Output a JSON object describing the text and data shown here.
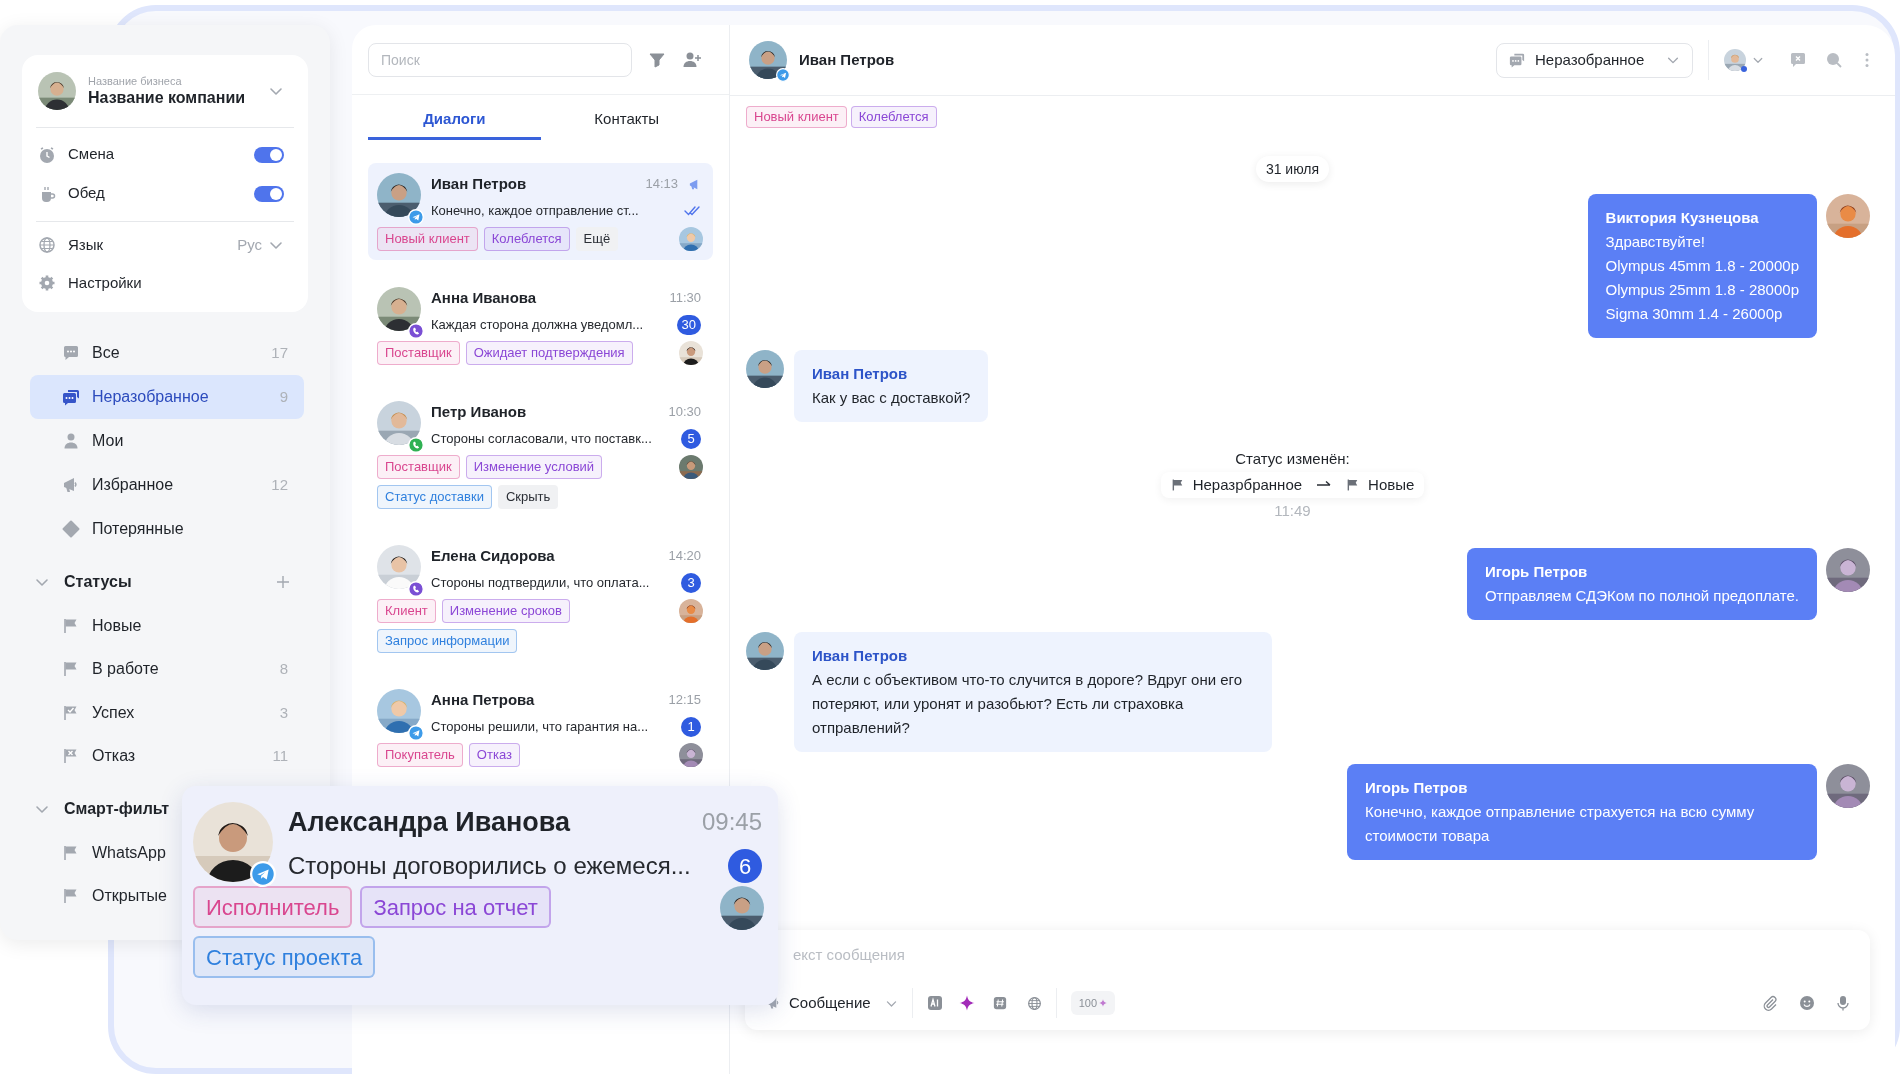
{
  "sidebar": {
    "business": {
      "caption": "Название бизнеса",
      "name": "Название компании"
    },
    "toggles": [
      {
        "label": "Смена",
        "on": true
      },
      {
        "label": "Обед",
        "on": true
      }
    ],
    "language": {
      "label": "Язык",
      "value": "Рус"
    },
    "settings": {
      "label": "Настройки"
    },
    "folders": [
      {
        "label": "Все",
        "count": "17",
        "selected": false
      },
      {
        "label": "Неразобранное",
        "count": "9",
        "selected": true
      },
      {
        "label": "Мои",
        "selected": false
      },
      {
        "label": "Избранное",
        "count": "12",
        "selected": false
      },
      {
        "label": "Потерянные",
        "selected": false
      }
    ],
    "sections": [
      {
        "title": "Статусы",
        "expanded": true,
        "items": [
          {
            "label": "Новые",
            "kind": "flag"
          },
          {
            "label": "В работе",
            "count": "8",
            "kind": "flag"
          },
          {
            "label": "Успех",
            "count": "3",
            "kind": "success"
          },
          {
            "label": "Отказ",
            "count": "11",
            "kind": "refusal"
          }
        ]
      },
      {
        "title": "Смарт-фильт",
        "expanded": true,
        "items": [
          {
            "label": "WhatsApp",
            "kind": "flag"
          },
          {
            "label": "Открытые",
            "kind": "flag"
          }
        ]
      }
    ]
  },
  "chat_list": {
    "search": {
      "placeholder": "Поиск"
    },
    "tabs": [
      {
        "label": "Диалоги",
        "selected": true
      },
      {
        "label": "Контакты",
        "selected": false
      }
    ],
    "dialogs": [
      {
        "name": "Иван Петров",
        "time": "14:13",
        "preview": "Конечно, каждое отправление ст...",
        "kind": "telegram",
        "pinned": true,
        "read": true,
        "selected": true,
        "tags": [
          {
            "label": "Новый клиент",
            "color": "#d9468f"
          },
          {
            "label": "Колеблется",
            "color": "#8b47d6"
          }
        ],
        "action": {
          "label": "Ещё"
        }
      },
      {
        "name": "Анна Иванова",
        "time": "11:30",
        "preview": "Каждая сторона должна уведомл...",
        "kind": "viber",
        "unread": "30",
        "pinned": false,
        "read": false,
        "selected": false,
        "tags": [
          {
            "label": "Поставщик",
            "color": "#d9468f"
          },
          {
            "label": "Ожидает подтверждения",
            "color": "#8b47d6"
          }
        ]
      },
      {
        "name": "Петр Иванов",
        "time": "10:30",
        "preview": "Стороны согласовали, что поставк...",
        "kind": "whatsapp",
        "unread": "5",
        "pinned": false,
        "read": false,
        "selected": false,
        "tags": [
          {
            "label": "Поставщик",
            "color": "#d9468f"
          },
          {
            "label": "Изменение условий",
            "color": "#8b47d6"
          },
          {
            "label": "Статус доставки",
            "color": "#2f80de"
          }
        ],
        "action": {
          "label": "Скрыть"
        }
      },
      {
        "name": "Елена Сидорова",
        "time": "14:20",
        "preview": "Стороны подтвердили, что оплата...",
        "kind": "viber",
        "unread": "3",
        "pinned": false,
        "read": false,
        "selected": false,
        "tags": [
          {
            "label": "Клиент",
            "color": "#d9468f"
          },
          {
            "label": "Изменение сроков",
            "color": "#8b47d6"
          },
          {
            "label": "Запрос информации",
            "color": "#2f80de"
          }
        ]
      },
      {
        "name": "Анна Петрова",
        "time": "12:15",
        "preview": "Стороны решили, что гарантия на...",
        "kind": "telegram",
        "unread": "1",
        "pinned": false,
        "read": false,
        "selected": false,
        "tags": [
          {
            "label": "Покупатель",
            "color": "#d9468f"
          },
          {
            "label": "Отказ",
            "color": "#8b47d6"
          }
        ]
      }
    ]
  },
  "floating_dialog": {
    "name": "Александра Иванова",
    "time": "09:45",
    "preview": "Стороны договорились о ежемеся...",
    "kind": "telegram",
    "unread": "6",
    "tags": [
      {
        "label": "Исполнитель",
        "color": "#d9468f"
      },
      {
        "label": "Запрос на отчет",
        "color": "#8b47d6"
      },
      {
        "label": "Статус проекта",
        "color": "#2f80de"
      }
    ]
  },
  "chat": {
    "contact": {
      "name": "Иван Петров",
      "kind": "telegram"
    },
    "status": {
      "label": "Неразобранное"
    },
    "tags": [
      {
        "label": "Новый клиент",
        "color": "#d9468f"
      },
      {
        "label": "Колеблется",
        "color": "#8b47d6"
      }
    ],
    "messages": [
      {
        "kind": "date",
        "text": "31 июля"
      },
      {
        "kind": "outgoing",
        "author": "Виктория Кузнецова",
        "paragraphs": [
          "Здравствуйте!",
          "Olympus 45mm 1.8 - 20000р",
          "Olympus 25mm 1.8 - 28000р",
          "Sigma 30mm 1.4 - 26000р"
        ]
      },
      {
        "kind": "incoming",
        "author": "Иван Петров",
        "paragraphs": [
          "Как у вас с доставкой?"
        ]
      },
      {
        "kind": "status_change",
        "title": "Статус изменён:",
        "from": "Неразрбранное",
        "to": "Новые",
        "time": "11:49"
      },
      {
        "kind": "outgoing",
        "author": "Игорь Петров",
        "paragraphs": [
          "Отправляем СДЭКом по полной предоплате."
        ]
      },
      {
        "kind": "incoming",
        "author": "Иван Петров",
        "paragraphs": [
          "А если с объективом что-то случится в дороге? Вдруг они его потеряют, или уронят и разобьют? Есть ли страховка отправлений?"
        ]
      },
      {
        "kind": "outgoing",
        "author": "Игорь Петров",
        "paragraphs": [
          "Конечно, каждое отправление страхуется на всю сумму стоимости товара"
        ]
      }
    ],
    "composer": {
      "placeholder": "екст сообщения",
      "mode": "Сообщение",
      "credits": "100"
    }
  }
}
